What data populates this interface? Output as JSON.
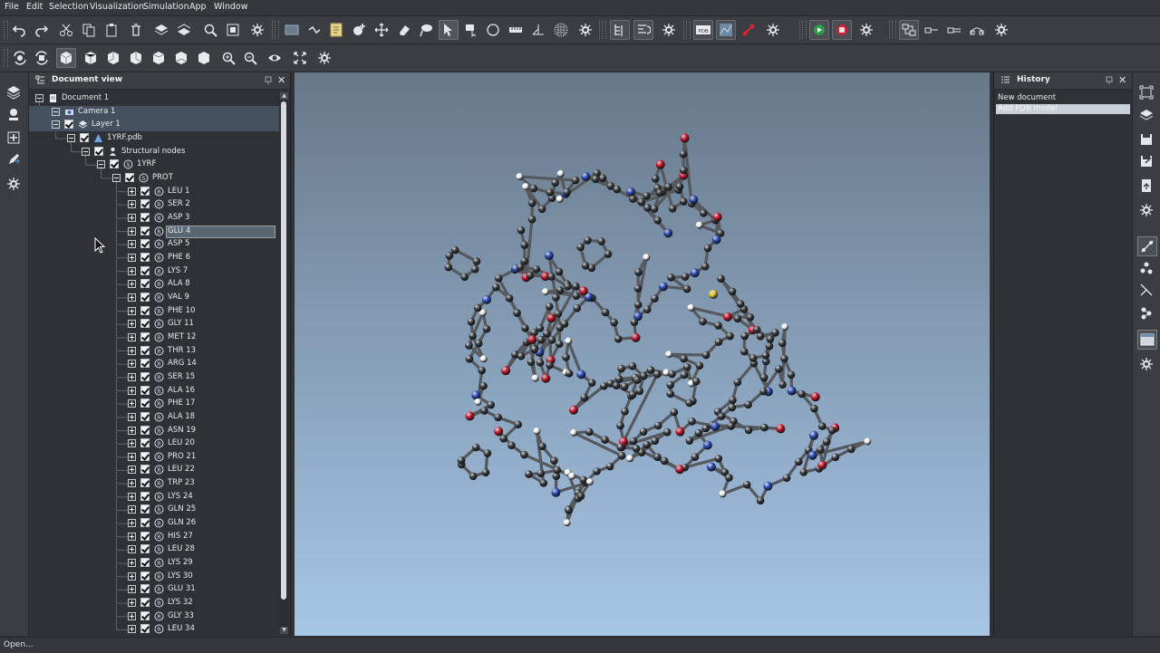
{
  "menu": [
    "File",
    "Edit",
    "Selection",
    "Visualization",
    "Simulation",
    "App",
    "Window"
  ],
  "toolbar_row1_icons": [
    "undo-icon",
    "redo-icon",
    "cut-icon",
    "copy-icon",
    "paste-icon",
    "delete-icon",
    "layer-up-icon",
    "layer-down-icon",
    "zoom-icon",
    "fit-icon",
    "settings-icon",
    "grid-icon",
    "bond-icon",
    "document-icon",
    "add-atom-icon",
    "move-icon",
    "eraser-icon",
    "lasso-icon",
    "select-arrow-icon",
    "rect-select-icon",
    "circle-icon",
    "ruler-icon",
    "angle-icon",
    "surface-icon",
    "settings-icon",
    "tree-icon",
    "list-icon",
    "settings-icon",
    "pdb-icon",
    "map-icon",
    "link-icon",
    "settings-icon",
    "play-icon",
    "record-icon",
    "settings-icon",
    "replace-icon",
    "bond-single-icon",
    "bond-double-icon",
    "bond-ring-icon",
    "settings-icon"
  ],
  "toolbar_row2_icons": [
    "rotate-view-icon",
    "rotate-select-icon",
    "cube-front-icon",
    "cube-back-icon",
    "cube-left-icon",
    "cube-right-icon",
    "cube-top-icon",
    "cube-bottom-icon",
    "cube-iso-icon",
    "zoom-in-icon",
    "zoom-out-icon",
    "eye-icon",
    "fit-all-icon",
    "settings-icon"
  ],
  "document_view": {
    "title": "Document view",
    "items": [
      {
        "label": "Document 1",
        "level": 0,
        "icon": "document-icon",
        "checkbox": false
      },
      {
        "label": "Camera 1",
        "level": 1,
        "icon": "camera-icon",
        "checkbox": false,
        "selected": true
      },
      {
        "label": "Layer 1",
        "level": 1,
        "icon": "layer-icon",
        "checkbox": true,
        "selected": true
      },
      {
        "label": "1YRF.pdb",
        "level": 2,
        "icon": "molecule-icon",
        "checkbox": true
      },
      {
        "label": "Structural nodes",
        "level": 3,
        "icon": "structure-icon",
        "checkbox": true
      },
      {
        "label": "1YRF",
        "level": 4,
        "icon": "chain-icon",
        "checkbox": true
      },
      {
        "label": "PROT",
        "level": 5,
        "icon": "chain-icon",
        "checkbox": true
      },
      {
        "label": "LEU 1",
        "level": 6,
        "icon": "residue-icon",
        "checkbox": true
      },
      {
        "label": "SER 2",
        "level": 6,
        "icon": "residue-icon",
        "checkbox": true
      },
      {
        "label": "ASP 3",
        "level": 6,
        "icon": "residue-icon",
        "checkbox": true
      },
      {
        "label": "GLU 4",
        "level": 6,
        "icon": "residue-icon",
        "checkbox": true,
        "highlighted": true
      },
      {
        "label": "ASP 5",
        "level": 6,
        "icon": "residue-icon",
        "checkbox": true
      },
      {
        "label": "PHE 6",
        "level": 6,
        "icon": "residue-icon",
        "checkbox": true
      },
      {
        "label": "LYS 7",
        "level": 6,
        "icon": "residue-icon",
        "checkbox": true
      },
      {
        "label": "ALA 8",
        "level": 6,
        "icon": "residue-icon",
        "checkbox": true
      },
      {
        "label": "VAL 9",
        "level": 6,
        "icon": "residue-icon",
        "checkbox": true
      },
      {
        "label": "PHE 10",
        "level": 6,
        "icon": "residue-icon",
        "checkbox": true
      },
      {
        "label": "GLY 11",
        "level": 6,
        "icon": "residue-icon",
        "checkbox": true
      },
      {
        "label": "MET 12",
        "level": 6,
        "icon": "residue-icon",
        "checkbox": true
      },
      {
        "label": "THR 13",
        "level": 6,
        "icon": "residue-icon",
        "checkbox": true
      },
      {
        "label": "ARG 14",
        "level": 6,
        "icon": "residue-icon",
        "checkbox": true
      },
      {
        "label": "SER 15",
        "level": 6,
        "icon": "residue-icon",
        "checkbox": true
      },
      {
        "label": "ALA 16",
        "level": 6,
        "icon": "residue-icon",
        "checkbox": true
      },
      {
        "label": "PHE 17",
        "level": 6,
        "icon": "residue-icon",
        "checkbox": true
      },
      {
        "label": "ALA 18",
        "level": 6,
        "icon": "residue-icon",
        "checkbox": true
      },
      {
        "label": "ASN 19",
        "level": 6,
        "icon": "residue-icon",
        "checkbox": true
      },
      {
        "label": "LEU 20",
        "level": 6,
        "icon": "residue-icon",
        "checkbox": true
      },
      {
        "label": "PRO 21",
        "level": 6,
        "icon": "residue-icon",
        "checkbox": true
      },
      {
        "label": "LEU 22",
        "level": 6,
        "icon": "residue-icon",
        "checkbox": true
      },
      {
        "label": "TRP 23",
        "level": 6,
        "icon": "residue-icon",
        "checkbox": true
      },
      {
        "label": "LYS 24",
        "level": 6,
        "icon": "residue-icon",
        "checkbox": true
      },
      {
        "label": "GLN 25",
        "level": 6,
        "icon": "residue-icon",
        "checkbox": true
      },
      {
        "label": "GLN 26",
        "level": 6,
        "icon": "residue-icon",
        "checkbox": true
      },
      {
        "label": "HIS 27",
        "level": 6,
        "icon": "residue-icon",
        "checkbox": true
      },
      {
        "label": "LEU 28",
        "level": 6,
        "icon": "residue-icon",
        "checkbox": true
      },
      {
        "label": "LYS 29",
        "level": 6,
        "icon": "residue-icon",
        "checkbox": true
      },
      {
        "label": "LYS 30",
        "level": 6,
        "icon": "residue-icon",
        "checkbox": true
      },
      {
        "label": "GLU 31",
        "level": 6,
        "icon": "residue-icon",
        "checkbox": true
      },
      {
        "label": "LYS 32",
        "level": 6,
        "icon": "residue-icon",
        "checkbox": true
      },
      {
        "label": "GLY 33",
        "level": 6,
        "icon": "residue-icon",
        "checkbox": true
      },
      {
        "label": "LEU 34",
        "level": 6,
        "icon": "residue-icon",
        "checkbox": true
      }
    ]
  },
  "history": {
    "title": "History",
    "items": [
      {
        "label": "New document",
        "selected": false
      },
      {
        "label": "Add PDB model",
        "selected": true
      }
    ]
  },
  "viewport": {
    "atom_colors": {
      "carbon": "#3b3d40",
      "oxygen": "#d0142a",
      "nitrogen": "#2f4fc0",
      "hydrogen": "#f2f2f2",
      "sulfur": "#e6d21a"
    }
  },
  "left_sidebar_icons": [
    "scene-icon",
    "tools-icon",
    "add-icon",
    "pen-icon",
    "settings-icon"
  ],
  "right_sidebar_icons": [
    "select-icon",
    "layer-icon",
    "save-icon",
    "save-as-icon",
    "export-icon",
    "settings-icon",
    "bond-tool-icon",
    "atom-tool-icon",
    "line-tool-icon",
    "molecule-tool-icon",
    "display-icon",
    "settings-icon"
  ],
  "status": "Open..."
}
